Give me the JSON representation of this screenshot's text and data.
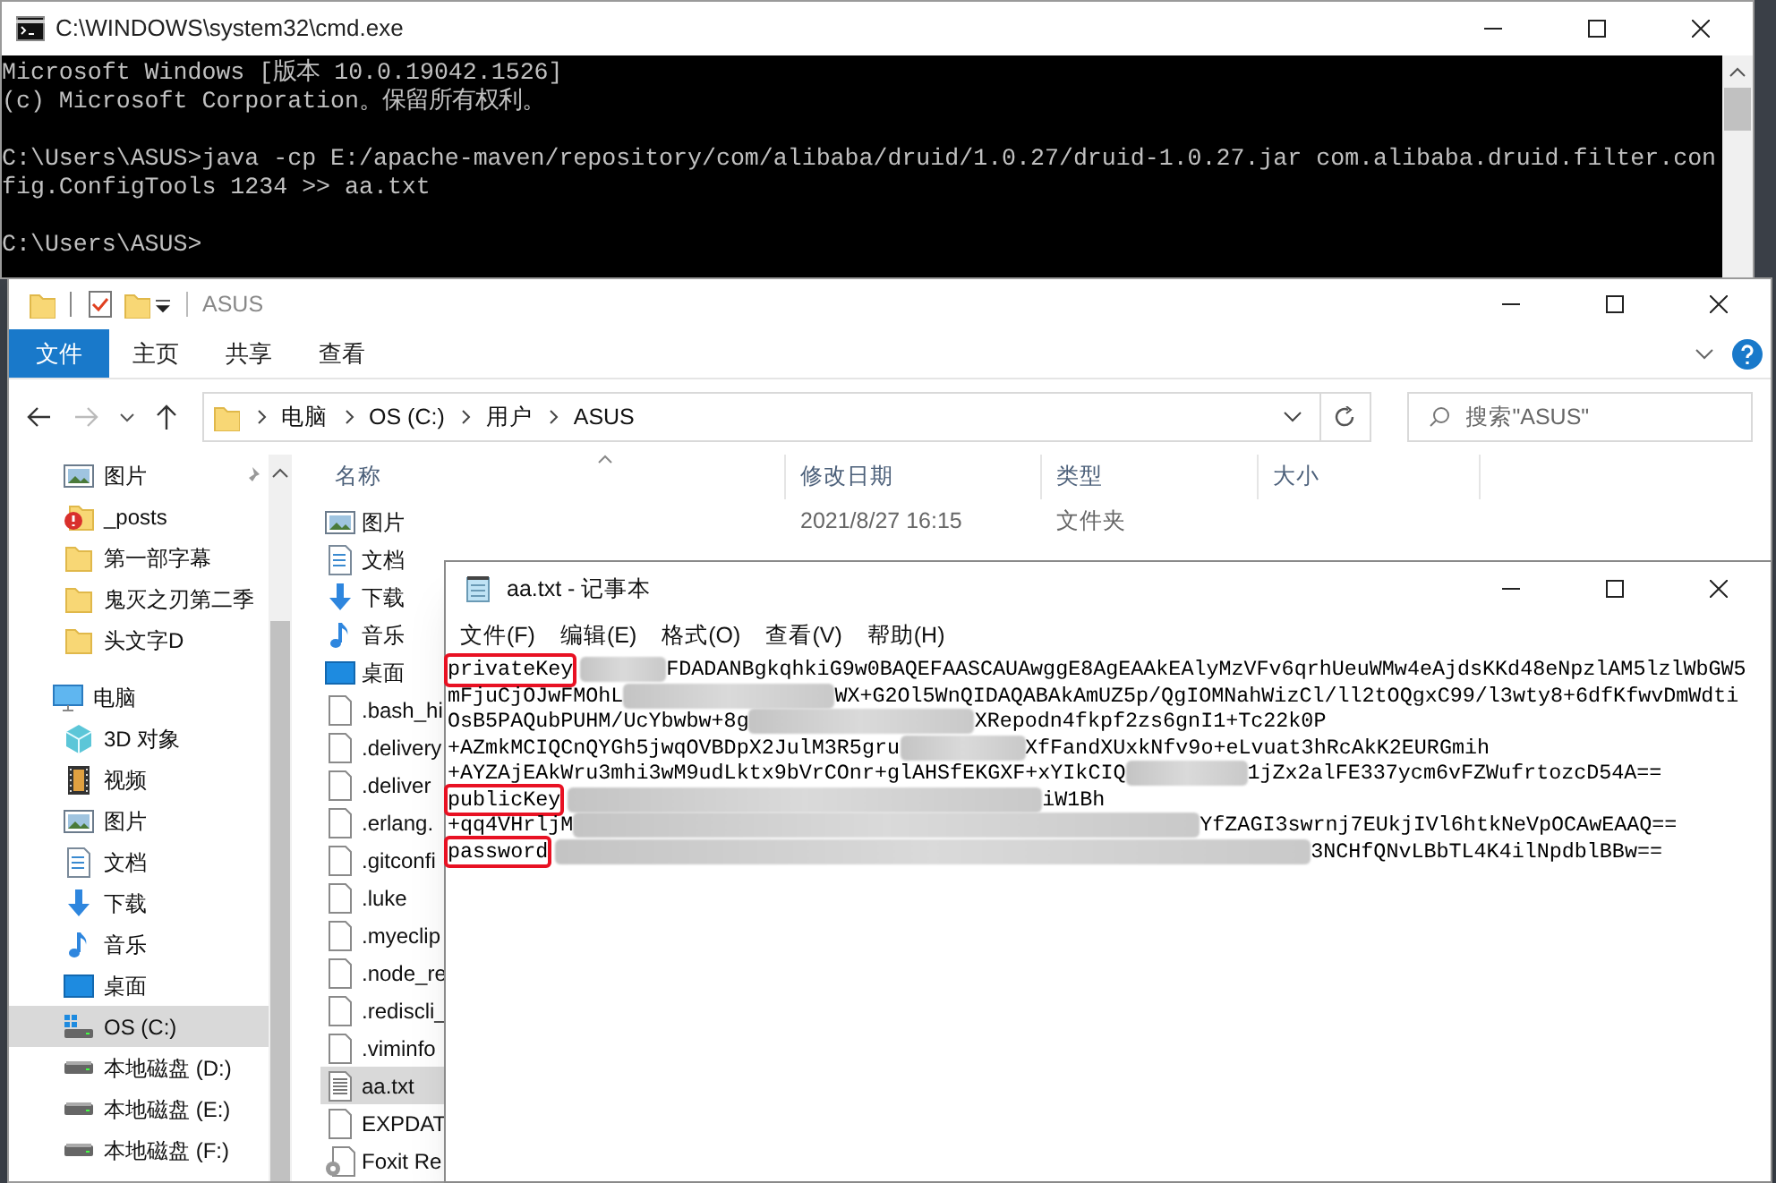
{
  "cmd_window": {
    "title": "C:\\WINDOWS\\system32\\cmd.exe",
    "blocks": [
      [
        "Microsoft Windows [版本 10.0.19042.1526]",
        "(c) Microsoft Corporation。保留所有权利。"
      ],
      [
        "C:\\Users\\ASUS>java -cp E:/apache-maven/repository/com/alibaba/druid/1.0.27/druid-1.0.27.jar com.alibaba.druid.filter.con",
        "fig.ConfigTools 1234 >> aa.txt"
      ],
      [
        "C:\\Users\\ASUS>"
      ]
    ]
  },
  "explorer": {
    "title": "ASUS",
    "ribbon_tabs": [
      {
        "label": "文件",
        "selected": true
      },
      {
        "label": "主页",
        "selected": false
      },
      {
        "label": "共享",
        "selected": false
      },
      {
        "label": "查看",
        "selected": false
      }
    ],
    "forward_disabled": true,
    "breadcrumb": [
      "电脑",
      "OS (C:)",
      "用户",
      "ASUS"
    ],
    "search": {
      "placeholder": "搜索\"ASUS\""
    },
    "nav_items": [
      {
        "label": "图片",
        "kind": "picture",
        "pinned": true,
        "selected": false
      },
      {
        "label": "_posts",
        "kind": "folder-alert",
        "pinned": false,
        "selected": false
      },
      {
        "label": "第一部字幕",
        "kind": "folder",
        "pinned": false,
        "selected": false
      },
      {
        "label": "鬼灭之刃第二季",
        "kind": "folder",
        "pinned": false,
        "selected": false
      },
      {
        "label": "头文字D",
        "kind": "folder",
        "pinned": false,
        "selected": false
      },
      {
        "label": "电脑",
        "kind": "pc",
        "pinned": false,
        "selected": false
      },
      {
        "label": "3D 对象",
        "kind": "cube",
        "pinned": false,
        "selected": false
      },
      {
        "label": "视频",
        "kind": "film",
        "pinned": false,
        "selected": false
      },
      {
        "label": "图片",
        "kind": "picture",
        "pinned": false,
        "selected": false
      },
      {
        "label": "文档",
        "kind": "document",
        "pinned": false,
        "selected": false
      },
      {
        "label": "下载",
        "kind": "download",
        "pinned": false,
        "selected": false
      },
      {
        "label": "音乐",
        "kind": "music",
        "pinned": false,
        "selected": false
      },
      {
        "label": "桌面",
        "kind": "desktop",
        "pinned": false,
        "selected": false
      },
      {
        "label": "OS (C:)",
        "kind": "drive-windows",
        "pinned": false,
        "selected": true
      },
      {
        "label": "本地磁盘 (D:)",
        "kind": "drive",
        "pinned": false,
        "selected": false
      },
      {
        "label": "本地磁盘 (E:)",
        "kind": "drive",
        "pinned": false,
        "selected": false
      },
      {
        "label": "本地磁盘 (F:)",
        "kind": "drive",
        "pinned": false,
        "selected": false
      }
    ],
    "columns": [
      {
        "label": "名称",
        "sorted": true
      },
      {
        "label": "修改日期",
        "sorted": false
      },
      {
        "label": "类型",
        "sorted": false
      },
      {
        "label": "大小",
        "sorted": false
      }
    ],
    "files": [
      {
        "name": "图片",
        "kind": "picture",
        "date": "2021/8/27 16:15",
        "type": "文件夹",
        "selected": false
      },
      {
        "name": "文档",
        "kind": "document",
        "selected": false
      },
      {
        "name": "下载",
        "kind": "download",
        "selected": false
      },
      {
        "name": "音乐",
        "kind": "music",
        "selected": false
      },
      {
        "name": "桌面",
        "kind": "desktop",
        "selected": false
      },
      {
        "name": ".bash_hi",
        "kind": "file",
        "selected": false
      },
      {
        "name": ".delivery",
        "kind": "file",
        "selected": false
      },
      {
        "name": ".deliver",
        "kind": "file",
        "selected": false
      },
      {
        "name": ".erlang.",
        "kind": "file",
        "selected": false
      },
      {
        "name": ".gitconfi",
        "kind": "file",
        "selected": false
      },
      {
        "name": ".luke",
        "kind": "file",
        "selected": false
      },
      {
        "name": ".myeclip",
        "kind": "file",
        "selected": false
      },
      {
        "name": ".node_re",
        "kind": "file",
        "selected": false
      },
      {
        "name": ".rediscli_",
        "kind": "file",
        "selected": false
      },
      {
        "name": ".viminfo",
        "kind": "file",
        "selected": false
      },
      {
        "name": "aa.txt",
        "kind": "text-file",
        "selected": true
      },
      {
        "name": "EXPDAT",
        "kind": "file",
        "selected": false
      },
      {
        "name": "Foxit Re",
        "kind": "gear-file",
        "selected": false
      }
    ]
  },
  "notepad": {
    "title": "aa.txt - 记事本",
    "menu": [
      "文件(F)",
      "编辑(E)",
      "格式(O)",
      "查看(V)",
      "帮助(H)"
    ],
    "lines": [
      {
        "key": "privateKey",
        "right": "FDADANBgkqhkiG9w0BAQEFAASCAUAwggE8AgEAAkEAlyMzVFv6qrhUeuWMw4eAjdsKKd48eNpzlAM5lzlWbGW5"
      },
      {
        "left": "mFjuCjOJwFMOhL",
        "right": "WX+G2Ol5WnQIDAQABAkAmUZ5p/QgIOMNahWizCl/ll2tOQgxC99/l3wty8+6dfKfwvDmWdti"
      },
      {
        "left": "OsB5PAQubPUHM/UcYbwbw+8g",
        "right": "XRepodn4fkpf2zs6gnI1+Tc22k0P"
      },
      {
        "left": "+AZmkMCIQCnQYGh5jwqOVBDpX2JulM3R5gru",
        "right": "XfFandXUxkNfv9o+eLvuat3hRcAkK2EURGmih"
      },
      {
        "left": "+AYZAjEAkWru3mhi3wM9udLktx9bVrCOnr+glAHSfEKGXF+xYIkCIQ",
        "right": "1jZx2alFE337ycm6vFZWufrtozcD54A=="
      },
      {
        "key": "publicKey",
        "right": "iW1Bh"
      },
      {
        "left": "+qq4VHrljM",
        "right": "YfZAGI3swrnj7EUkjIVl6htkNeVpOCAwEAAQ=="
      },
      {
        "key": "password",
        "right": "3NCHfQNvLBbTL4K4ilNpdblBBw=="
      }
    ]
  }
}
